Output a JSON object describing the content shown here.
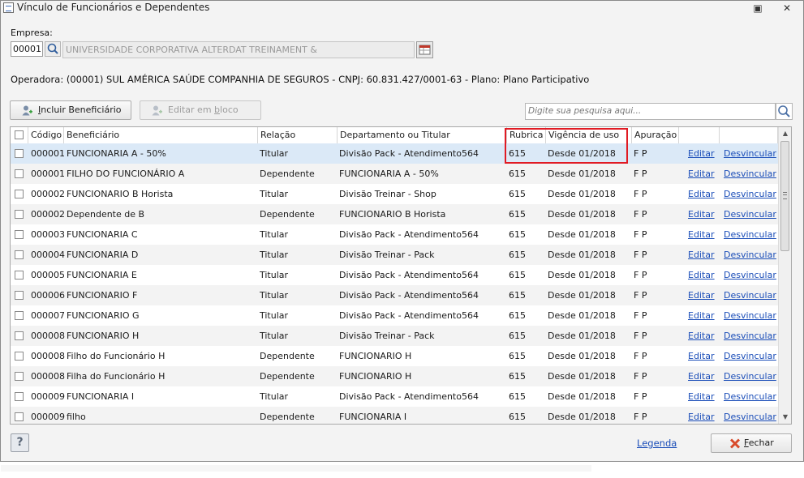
{
  "window": {
    "title": "Vínculo de Funcionários e Dependentes"
  },
  "empresa": {
    "label": "Empresa:",
    "code": "00001",
    "name": "UNIVERSIDADE CORPORATIVA ALTERDAT TREINAMENT &"
  },
  "operadora_text": "Operadora: (00001) SUL AMÉRICA SAÚDE COMPANHIA DE SEGUROS - CNPJ: 60.831.427/0001-63 - Plano: Plano Participativo",
  "toolbar": {
    "include_label": "Incluir Beneficiário",
    "include_mnemonic": "I",
    "include_rest": "ncluir Beneficiário",
    "edit_block_label": "Editar em bloco",
    "edit_block_pre": "Editar em ",
    "edit_block_mnemonic": "b",
    "edit_block_post": "loco",
    "search_placeholder": "Digite sua pesquisa aqui..."
  },
  "columns": {
    "codigo": "Código",
    "beneficiario": "Beneficiário",
    "relacao": "Relação",
    "departamento": "Departamento ou Titular",
    "rubrica": "Rubrica",
    "vigencia": "Vigência de uso",
    "apuracao": "Apuração"
  },
  "rows": [
    {
      "codigo": "000001",
      "beneficiario": "FUNCIONARIA A - 50%",
      "relacao": "Titular",
      "departamento": "Divisão Pack - Atendimento564",
      "rubrica": "615",
      "vigencia": "Desde 01/2018",
      "apuracao": "F P",
      "editar": "Editar",
      "desvincular": "Desvincular"
    },
    {
      "codigo": "000001",
      "beneficiario": "FILHO DO FUNCIONÁRIO A",
      "relacao": "Dependente",
      "departamento": "FUNCIONARIA A - 50%",
      "rubrica": "615",
      "vigencia": "Desde 01/2018",
      "apuracao": "F P",
      "editar": "Editar",
      "desvincular": "Desvincular"
    },
    {
      "codigo": "000002",
      "beneficiario": "FUNCIONARIO  B Horista",
      "relacao": "Titular",
      "departamento": "Divisão Treinar - Shop",
      "rubrica": "615",
      "vigencia": "Desde 01/2018",
      "apuracao": "F P",
      "editar": "Editar",
      "desvincular": "Desvincular"
    },
    {
      "codigo": "000002",
      "beneficiario": "Dependente de B",
      "relacao": "Dependente",
      "departamento": "FUNCIONARIO  B Horista",
      "rubrica": "615",
      "vigencia": "Desde 01/2018",
      "apuracao": "F P",
      "editar": "Editar",
      "desvincular": "Desvincular"
    },
    {
      "codigo": "000003",
      "beneficiario": "FUNCIONARIA C",
      "relacao": "Titular",
      "departamento": "Divisão Pack - Atendimento564",
      "rubrica": "615",
      "vigencia": "Desde 01/2018",
      "apuracao": "F P",
      "editar": "Editar",
      "desvincular": "Desvincular"
    },
    {
      "codigo": "000004",
      "beneficiario": "FUNCIONARIA D",
      "relacao": "Titular",
      "departamento": "Divisão Treinar - Pack",
      "rubrica": "615",
      "vigencia": "Desde 01/2018",
      "apuracao": "F P",
      "editar": "Editar",
      "desvincular": "Desvincular"
    },
    {
      "codigo": "000005",
      "beneficiario": "FUNCIONARIA E",
      "relacao": "Titular",
      "departamento": "Divisão Pack - Atendimento564",
      "rubrica": "615",
      "vigencia": "Desde 01/2018",
      "apuracao": "F P",
      "editar": "Editar",
      "desvincular": "Desvincular"
    },
    {
      "codigo": "000006",
      "beneficiario": "FUNCIONARIO F",
      "relacao": "Titular",
      "departamento": "Divisão Pack - Atendimento564",
      "rubrica": "615",
      "vigencia": "Desde 01/2018",
      "apuracao": "F P",
      "editar": "Editar",
      "desvincular": "Desvincular"
    },
    {
      "codigo": "000007",
      "beneficiario": "FUNCIONARIO G",
      "relacao": "Titular",
      "departamento": "Divisão Pack - Atendimento564",
      "rubrica": "615",
      "vigencia": "Desde 01/2018",
      "apuracao": "F P",
      "editar": "Editar",
      "desvincular": "Desvincular"
    },
    {
      "codigo": "000008",
      "beneficiario": "FUNCIONARIO H",
      "relacao": "Titular",
      "departamento": "Divisão Treinar - Pack",
      "rubrica": "615",
      "vigencia": "Desde 01/2018",
      "apuracao": "F P",
      "editar": "Editar",
      "desvincular": "Desvincular"
    },
    {
      "codigo": "000008",
      "beneficiario": "Filho do Funcionário H",
      "relacao": "Dependente",
      "departamento": "FUNCIONARIO H",
      "rubrica": "615",
      "vigencia": "Desde 01/2018",
      "apuracao": "F P",
      "editar": "Editar",
      "desvincular": "Desvincular"
    },
    {
      "codigo": "000008",
      "beneficiario": "Filha do Funcionário H",
      "relacao": "Dependente",
      "departamento": "FUNCIONARIO H",
      "rubrica": "615",
      "vigencia": "Desde 01/2018",
      "apuracao": "F P",
      "editar": "Editar",
      "desvincular": "Desvincular"
    },
    {
      "codigo": "000009",
      "beneficiario": "FUNCIONARIA I",
      "relacao": "Titular",
      "departamento": "Divisão Pack - Atendimento564",
      "rubrica": "615",
      "vigencia": "Desde 01/2018",
      "apuracao": "F P",
      "editar": "Editar",
      "desvincular": "Desvincular"
    },
    {
      "codigo": "000009",
      "beneficiario": "filho",
      "relacao": "Dependente",
      "departamento": "FUNCIONARIA I",
      "rubrica": "615",
      "vigencia": "Desde 01/2018",
      "apuracao": "F P",
      "editar": "Editar",
      "desvincular": "Desvincular"
    }
  ],
  "footer": {
    "help_label": "?",
    "legenda_label": "Legenda",
    "close_label": "Fechar",
    "close_mnemonic": "F",
    "close_rest": "echar"
  },
  "colors": {
    "link": "#1a4db8",
    "selected_row": "#dbe9f7",
    "highlight_box": "#e01b24",
    "close_icon": "#d84a2a"
  }
}
